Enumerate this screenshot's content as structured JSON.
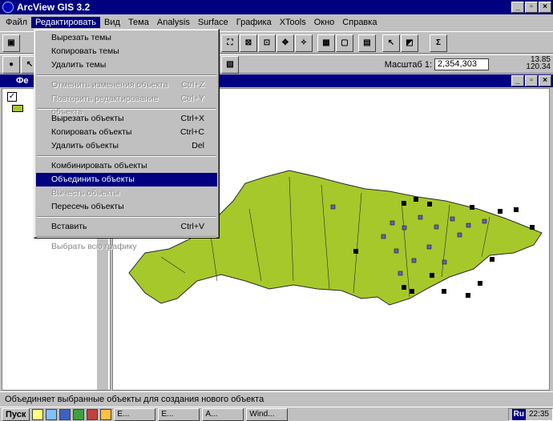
{
  "window": {
    "title": "ArcView GIS 3.2",
    "min": "_",
    "restore": "▫",
    "close": "×"
  },
  "menubar": [
    "Файл",
    "Редактировать",
    "Вид",
    "Тема",
    "Analysis",
    "Surface",
    "Графика",
    "XTools",
    "Окно",
    "Справка"
  ],
  "view": {
    "title_partial": "Фе",
    "scale_label": "Масштаб 1:",
    "scale_value": "2,354,303",
    "coord_x": "13.85",
    "coord_y": "120.34"
  },
  "edit_menu": {
    "groups": [
      [
        {
          "label": "Вырезать темы",
          "shortcut": "",
          "enabled": true
        },
        {
          "label": "Копировать темы",
          "shortcut": "",
          "enabled": true
        },
        {
          "label": "Удалить темы",
          "shortcut": "",
          "enabled": true
        }
      ],
      [
        {
          "label": "Отменить изменения объекта",
          "shortcut": "Ctrl+Z",
          "enabled": false
        },
        {
          "label": "Повторить редактирование объекта",
          "shortcut": "Ctrl+Y",
          "enabled": false
        }
      ],
      [
        {
          "label": "Вырезать объекты",
          "shortcut": "Ctrl+X",
          "enabled": true
        },
        {
          "label": "Копировать объекты",
          "shortcut": "Ctrl+C",
          "enabled": true
        },
        {
          "label": "Удалить объекты",
          "shortcut": "Del",
          "enabled": true
        }
      ],
      [
        {
          "label": "Комбинировать объекты",
          "shortcut": "",
          "enabled": true
        },
        {
          "label": "Объединить объекты",
          "shortcut": "",
          "enabled": true,
          "highlighted": true
        },
        {
          "label": "Вычесть объекты",
          "shortcut": "",
          "enabled": false
        },
        {
          "label": "Пересечь объекты",
          "shortcut": "",
          "enabled": true
        }
      ],
      [
        {
          "label": "Вставить",
          "shortcut": "Ctrl+V",
          "enabled": true
        }
      ],
      [
        {
          "label": "Выбрать всю графику",
          "shortcut": "",
          "enabled": false
        }
      ]
    ]
  },
  "status": "Объединяет выбранные объекты для создания нового объекта",
  "taskbar": {
    "start": "Пуск",
    "tasks": [
      "E...",
      "E...",
      "A...",
      "Wind..."
    ],
    "lang": "Ru",
    "time": "22:35"
  },
  "colors": {
    "title": "#000080",
    "map_fill": "#a6c82b",
    "point": "#6a5acd"
  }
}
